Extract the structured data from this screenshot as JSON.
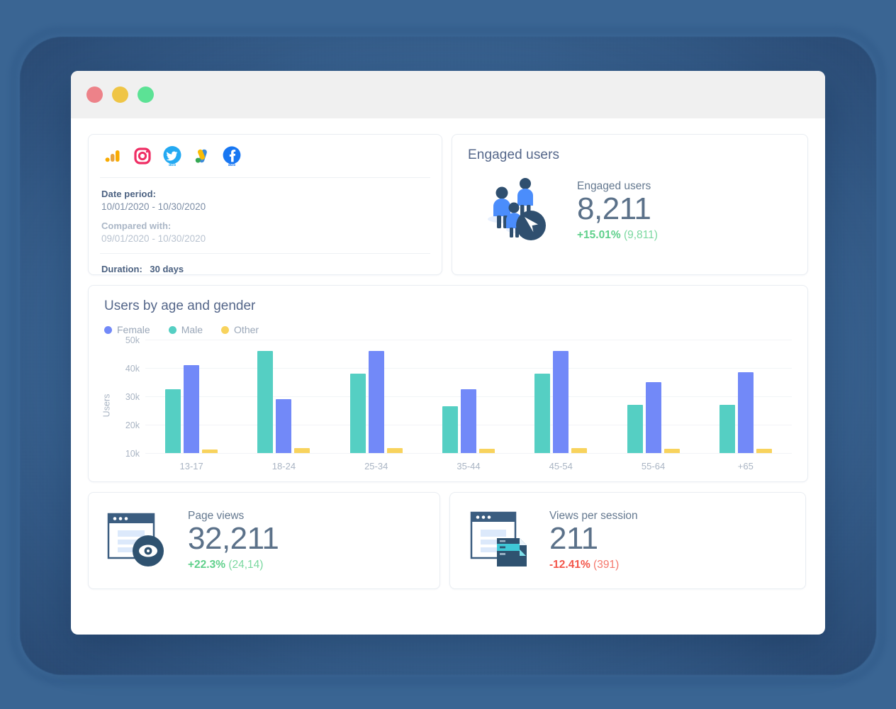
{
  "window": {
    "traffic_lights": [
      "close",
      "minimize",
      "maximize"
    ]
  },
  "date_card": {
    "integrations": [
      {
        "name": "google-analytics",
        "label": "Google Analytics"
      },
      {
        "name": "instagram",
        "label": "Instagram"
      },
      {
        "name": "twitter-ads",
        "label": "Twitter Ads"
      },
      {
        "name": "google-ads",
        "label": "Google Ads"
      },
      {
        "name": "facebook-ads",
        "label": "Facebook Ads"
      }
    ],
    "date_period_label": "Date period:",
    "date_period_value": "10/01/2020 - 10/30/2020",
    "compared_with_label": "Compared with:",
    "compared_with_value": "09/01/2020 - 10/30/2020",
    "duration_label": "Duration:",
    "duration_value": "30 days"
  },
  "engaged_card": {
    "title": "Engaged users",
    "metric_label": "Engaged users",
    "metric_value": "8,211",
    "delta_pct": "+15.01%",
    "delta_abs": "(9,811)",
    "delta_direction": "up"
  },
  "chart_card": {
    "title": "Users by age and gender"
  },
  "chart_data": {
    "type": "bar",
    "title": "Users by age and gender",
    "xlabel": "",
    "ylabel": "Users",
    "categories": [
      "13-17",
      "18-24",
      "25-34",
      "35-44",
      "45-54",
      "55-64",
      "+65"
    ],
    "ytick_labels": [
      "50k",
      "40k",
      "30k",
      "20k",
      "10k"
    ],
    "ytick_values": [
      50000,
      40000,
      30000,
      20000,
      10000
    ],
    "ylim": [
      10000,
      52000
    ],
    "grid": true,
    "legend_position": "top-left",
    "legend": [
      "Female",
      "Male",
      "Other"
    ],
    "bar_order": [
      "Male",
      "Female",
      "Other"
    ],
    "colors": {
      "Female": "#7289f8",
      "Male": "#55cfc3",
      "Other": "#f8d35d"
    },
    "series": [
      {
        "name": "Male",
        "color": "#55cfc3",
        "values": [
          32500,
          46000,
          38000,
          26500,
          38000,
          27000,
          27000
        ]
      },
      {
        "name": "Female",
        "color": "#7289f8",
        "values": [
          41000,
          29000,
          46000,
          32500,
          46000,
          35000,
          38500
        ]
      },
      {
        "name": "Other",
        "color": "#f8d35d",
        "values": [
          11200,
          11700,
          11700,
          11500,
          11700,
          11600,
          11400
        ]
      }
    ]
  },
  "page_views_card": {
    "metric_label": "Page views",
    "metric_value": "32,211",
    "delta_pct": "+22.3%",
    "delta_abs": "(24,14)",
    "delta_direction": "up"
  },
  "views_per_session_card": {
    "metric_label": "Views per session",
    "metric_value": "211",
    "delta_pct": "-12.41%",
    "delta_abs": "(391)",
    "delta_direction": "down"
  },
  "theme": {
    "background": "#3a6593",
    "accent_green": "#5fd08b",
    "accent_red": "#f3564a",
    "text_dark": "#41607f",
    "bar_female": "#7289f8",
    "bar_male": "#55cfc3",
    "bar_other": "#f8d35d"
  }
}
